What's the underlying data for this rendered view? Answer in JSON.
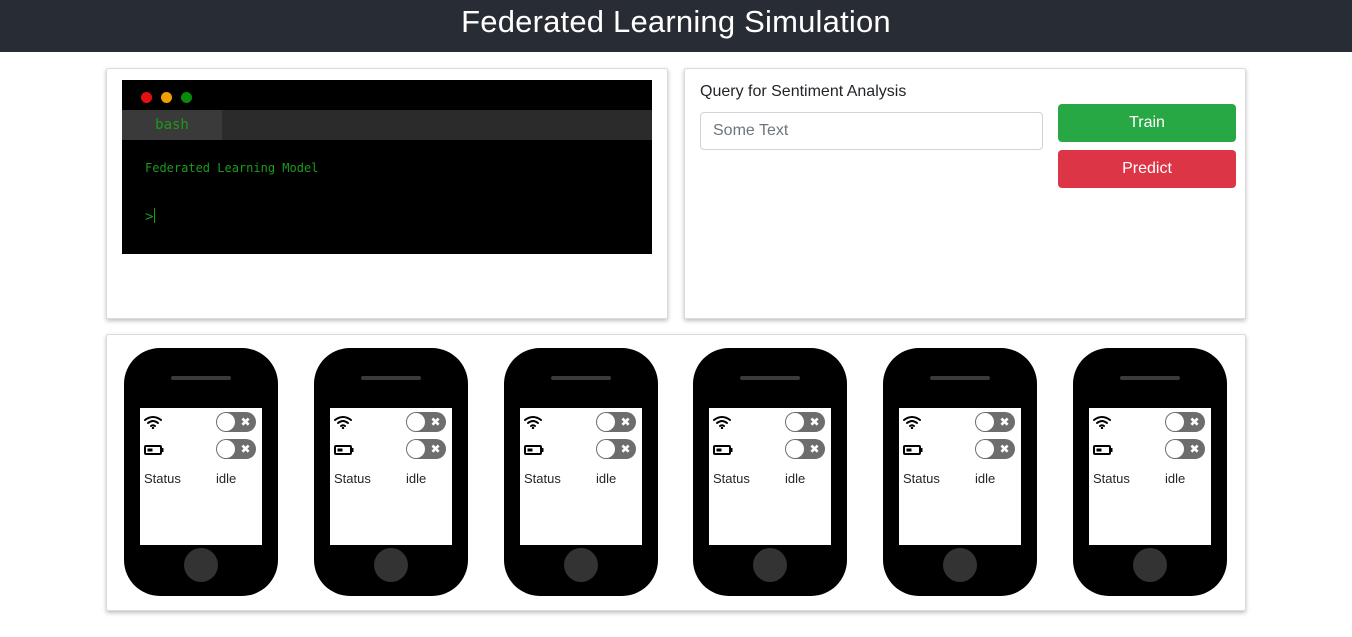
{
  "header": {
    "title": "Federated Learning Simulation"
  },
  "terminal": {
    "tab_label": "bash",
    "output_line": "Federated Learning Model",
    "prompt": ">"
  },
  "query": {
    "label": "Query for Sentiment Analysis",
    "input_value": "",
    "input_placeholder": "Some Text",
    "train_label": "Train",
    "predict_label": "Predict"
  },
  "devices": [
    {
      "status_label": "Status",
      "status_value": "idle",
      "wifi_on": false,
      "battery_on": false
    },
    {
      "status_label": "Status",
      "status_value": "idle",
      "wifi_on": false,
      "battery_on": false
    },
    {
      "status_label": "Status",
      "status_value": "idle",
      "wifi_on": false,
      "battery_on": false
    },
    {
      "status_label": "Status",
      "status_value": "idle",
      "wifi_on": false,
      "battery_on": false
    },
    {
      "status_label": "Status",
      "status_value": "idle",
      "wifi_on": false,
      "battery_on": false
    },
    {
      "status_label": "Status",
      "status_value": "idle",
      "wifi_on": false,
      "battery_on": false
    }
  ],
  "icons": {
    "toggle_off": "close-icon",
    "wifi": "wifi-icon",
    "battery": "battery-icon"
  },
  "colors": {
    "header_bg": "#282c34",
    "train": "#28a745",
    "predict": "#dc3545",
    "terminal_text": "#1c9a1c"
  }
}
